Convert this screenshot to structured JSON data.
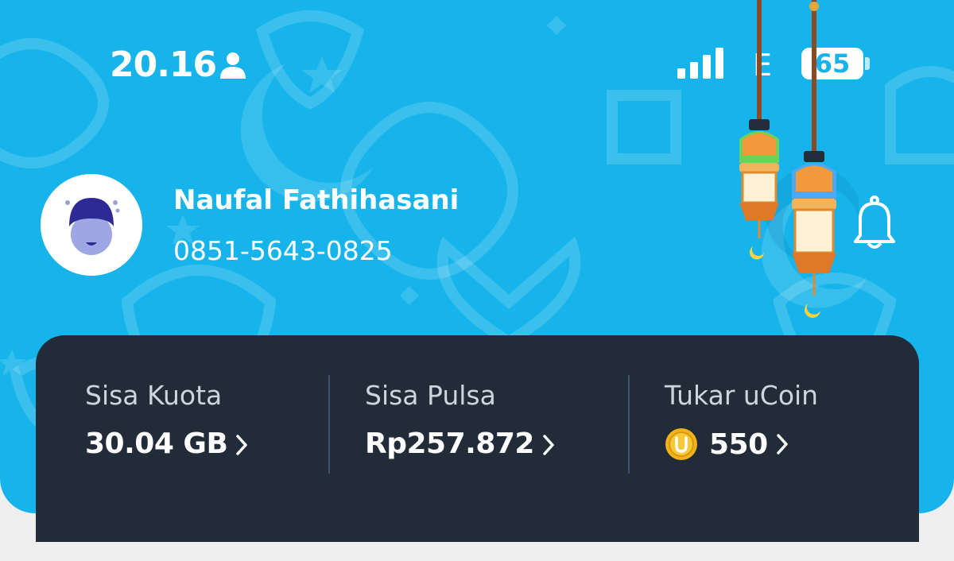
{
  "status_bar": {
    "time": "20.16",
    "network_type": "E",
    "battery_level": "65"
  },
  "profile": {
    "name": "Naufal Fathihasani",
    "phone": "0851-5643-0825"
  },
  "stats": [
    {
      "label": "Sisa Kuota",
      "value": "30.04 GB"
    },
    {
      "label": "Sisa Pulsa",
      "value": "Rp257.872"
    },
    {
      "label": "Tukar uCoin",
      "value": "550",
      "icon": "ucoin-icon"
    }
  ],
  "icons": {
    "person": "person-icon",
    "signal": "signal-icon",
    "battery": "battery-icon",
    "bell": "bell-icon",
    "chevron": "chevron-right-icon",
    "lantern": "lantern-decoration"
  },
  "colors": {
    "hero_background": "#16b4ea",
    "card_background": "#222b38",
    "coin": "#f2b31a"
  }
}
